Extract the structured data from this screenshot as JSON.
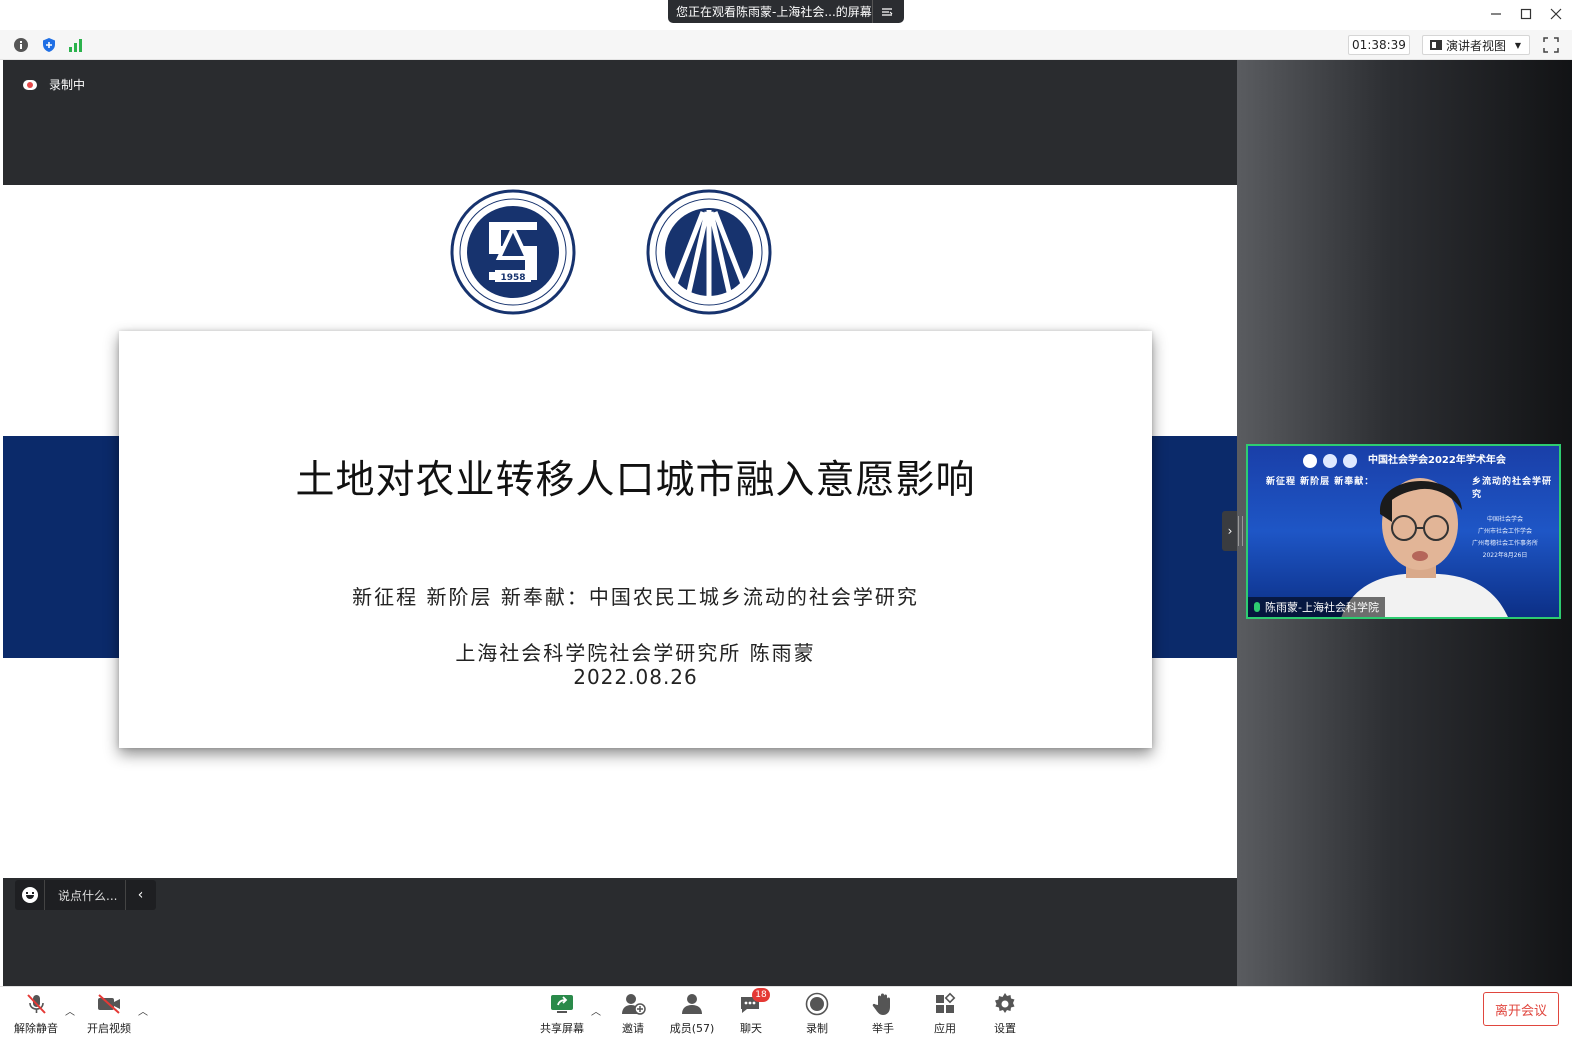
{
  "window": {
    "share_banner": "您正在观看陈雨蒙-上海社会...的屏幕"
  },
  "toolbar": {
    "timer": "01:38:39",
    "view_mode": "演讲者视图"
  },
  "stage": {
    "recording_label": "录制中",
    "comment_placeholder": "说点什么..."
  },
  "slide": {
    "title": "土地对农业转移人口城市融入意愿影响",
    "subtitle": "新征程 新阶层 新奉献：中国农民工城乡流动的社会学研究",
    "author": "上海社会科学院社会学研究所   陈雨蒙",
    "date": "2022.08.26",
    "logo_left_year": "1958"
  },
  "video": {
    "event_title": "中国社会学会2022年学术年会",
    "event_subtitle": "新征程 新阶层 新奉献：",
    "event_subtitle_tail": "乡流动的社会学研究",
    "org_lines": [
      "中国社会学会",
      "广州市社会工作学会",
      "广州粤穗社会工作事务所",
      "2022年8月26日"
    ],
    "participant_name": "陈雨蒙-上海社会科学院"
  },
  "bottombar": {
    "unmute": "解除静音",
    "start_video": "开启视频",
    "share_screen": "共享屏幕",
    "invite": "邀请",
    "members": "成员(57)",
    "chat": "聊天",
    "chat_badge": "18",
    "record": "录制",
    "raise_hand": "举手",
    "apps": "应用",
    "settings": "设置",
    "leave": "离开会议"
  },
  "colors": {
    "slide_band": "#0b2a6a",
    "leave_red": "#e0463e",
    "active_speaker": "#2ecc71"
  }
}
